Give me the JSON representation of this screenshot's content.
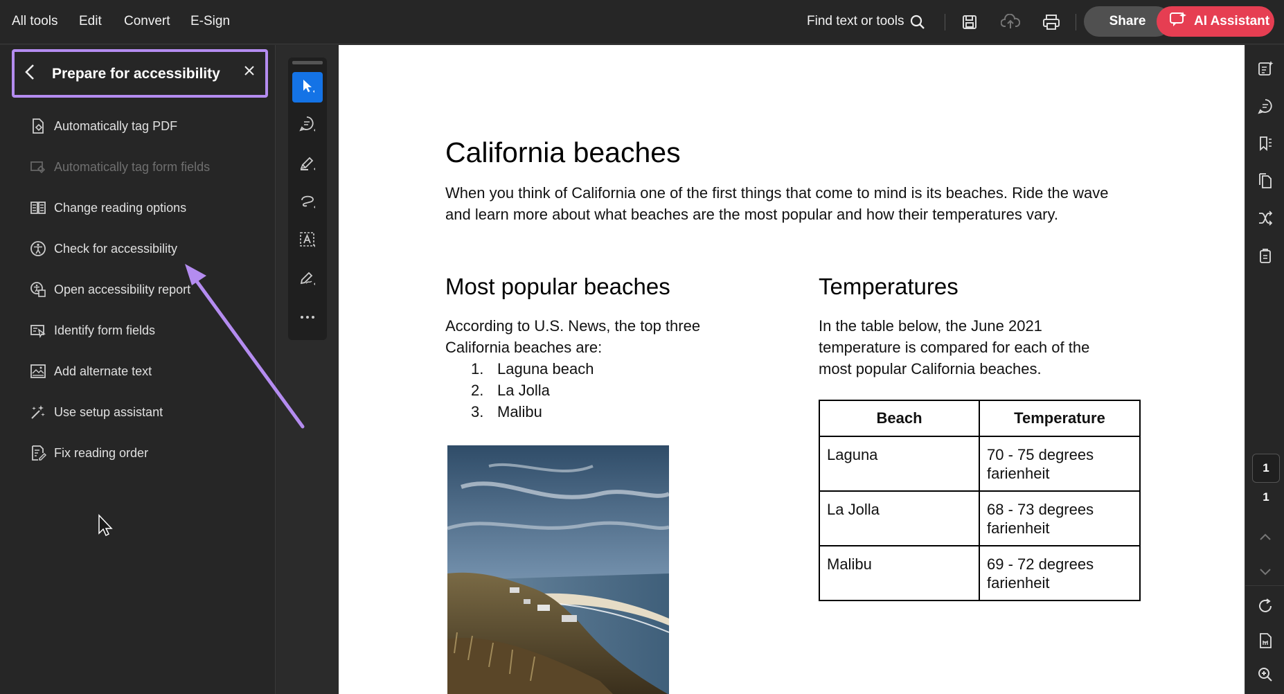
{
  "menu": {
    "all_tools": "All tools",
    "edit": "Edit",
    "convert": "Convert",
    "esign": "E-Sign"
  },
  "toolbar": {
    "find_label": "Find text or tools",
    "share_label": "Share",
    "ai_label": "AI Assistant",
    "icons": [
      "search-icon",
      "save-icon",
      "cloud-upload-icon",
      "print-icon"
    ]
  },
  "panel": {
    "title": "Prepare for accessibility",
    "items": [
      {
        "label": "Automatically tag PDF",
        "icon": "tag-pdf-icon",
        "enabled": true
      },
      {
        "label": "Automatically tag form fields",
        "icon": "tag-form-fields-icon",
        "enabled": false
      },
      {
        "label": "Change reading options",
        "icon": "reading-options-icon",
        "enabled": true
      },
      {
        "label": "Check for accessibility",
        "icon": "accessibility-check-icon",
        "enabled": true
      },
      {
        "label": "Open accessibility report",
        "icon": "accessibility-report-icon",
        "enabled": true
      },
      {
        "label": "Identify form fields",
        "icon": "form-fields-icon",
        "enabled": true
      },
      {
        "label": "Add alternate text",
        "icon": "alt-text-icon",
        "enabled": true
      },
      {
        "label": "Use setup assistant",
        "icon": "setup-assistant-icon",
        "enabled": true
      },
      {
        "label": "Fix reading order",
        "icon": "reading-order-icon",
        "enabled": true
      }
    ]
  },
  "vertical_tools": [
    "select-icon",
    "comment-icon",
    "highlight-icon",
    "draw-icon",
    "text-recognition-icon",
    "sign-icon",
    "more-icon"
  ],
  "document": {
    "title": "California beaches",
    "intro": "When you think of California one of the first things that come to mind is its beaches. Ride the wave and learn more about what beaches are the most popular and how their temperatures vary.",
    "popular_heading": "Most popular beaches",
    "popular_text": "According to U.S. News, the top three California beaches are:",
    "list": [
      {
        "num": "1.",
        "name": "Laguna beach"
      },
      {
        "num": "2.",
        "name": "La Jolla"
      },
      {
        "num": "3.",
        "name": "Malibu"
      }
    ],
    "temp_heading": "Temperatures",
    "temp_text": "In the table below, the June 2021 temperature is compared for each of the most popular California beaches.",
    "table": {
      "headers": [
        "Beach",
        "Temperature"
      ],
      "rows": [
        [
          "Laguna",
          "70 - 75 degrees farienheit"
        ],
        [
          "La Jolla",
          "68 - 73 degrees farienheit"
        ],
        [
          "Malibu",
          "69 - 72 degrees farienheit"
        ]
      ]
    }
  },
  "right_rail": {
    "current_page": "1",
    "total_pages": "1",
    "icons": [
      "ai-summary-icon",
      "comments-icon",
      "bookmarks-icon",
      "pages-icon",
      "compare-icon",
      "attachments-icon",
      "chevron-up-icon",
      "chevron-down-icon",
      "rotate-icon",
      "page-fit-icon",
      "zoom-in-icon"
    ]
  },
  "colors": {
    "accent_purple": "#b48cf0",
    "ai_button": "#e63e52",
    "select_tool": "#1473e6"
  }
}
